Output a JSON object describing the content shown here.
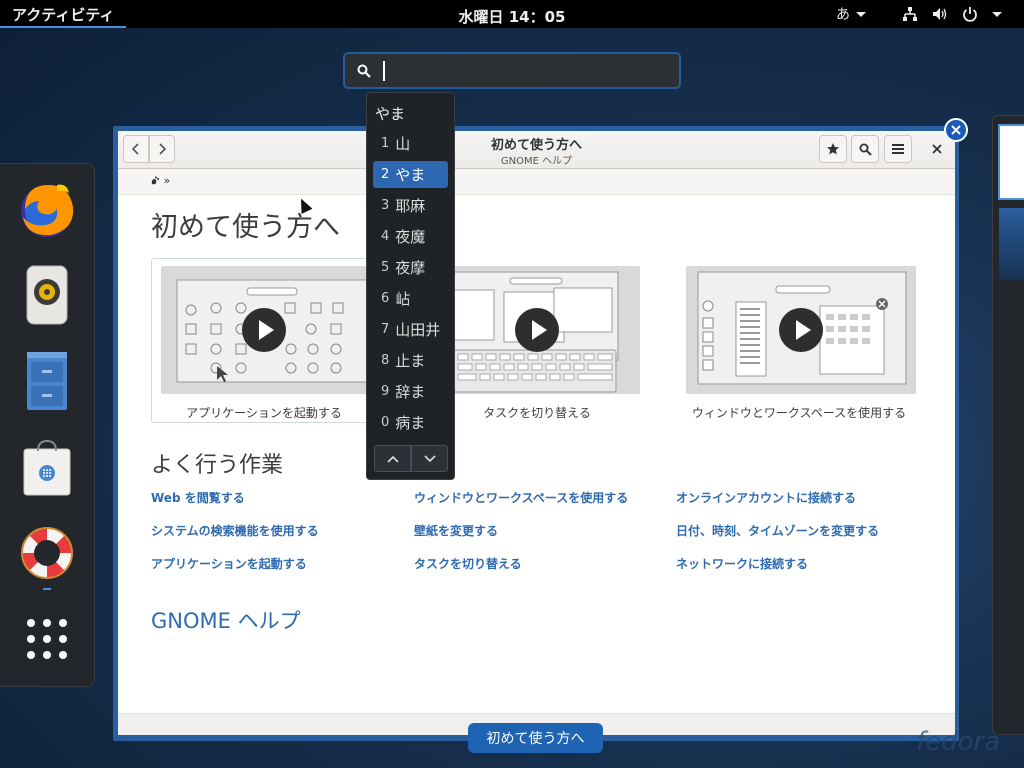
{
  "topbar": {
    "activities": "アクティビティ",
    "clock": "水曜日 14：05",
    "input_method": "あ"
  },
  "search": {
    "value": ""
  },
  "ime": {
    "preedit": "やま",
    "candidates": [
      {
        "index": "1",
        "text": "山",
        "selected": false
      },
      {
        "index": "2",
        "text": "やま",
        "selected": true
      },
      {
        "index": "3",
        "text": "耶麻",
        "selected": false
      },
      {
        "index": "4",
        "text": "夜魔",
        "selected": false
      },
      {
        "index": "5",
        "text": "夜摩",
        "selected": false
      },
      {
        "index": "6",
        "text": "岾",
        "selected": false
      },
      {
        "index": "7",
        "text": "山田井",
        "selected": false
      },
      {
        "index": "8",
        "text": "止ま",
        "selected": false
      },
      {
        "index": "9",
        "text": "辞ま",
        "selected": false
      },
      {
        "index": "0",
        "text": "病ま",
        "selected": false
      }
    ]
  },
  "dash": {
    "apps": [
      "firefox-icon",
      "rhythmbox-icon",
      "files-icon",
      "software-icon",
      "help-icon",
      "show-apps-icon"
    ]
  },
  "window": {
    "title": "初めて使う方へ",
    "subtitle": "GNOME ヘルプ",
    "breadcrumb": "»",
    "heading": "初めて使う方へ",
    "videos": [
      {
        "caption": "アプリケーションを起動する"
      },
      {
        "caption": "タスクを切り替える"
      },
      {
        "caption": "ウィンドウとワークスペースを使用する"
      }
    ],
    "tasks_heading": "よく行う作業",
    "tasks": [
      "Web を閲覧する",
      "ウィンドウとワークスペースを使用する",
      "オンラインアカウントに接続する",
      "システムの検索機能を使用する",
      "壁紙を変更する",
      "日付、時刻、タイムゾーンを変更する",
      "アプリケーションを起動する",
      "タスクを切り替える",
      "ネットワークに接続する"
    ],
    "footer_link": "GNOME ヘルプ",
    "label": "初めて使う方へ"
  },
  "watermark": "fedora"
}
